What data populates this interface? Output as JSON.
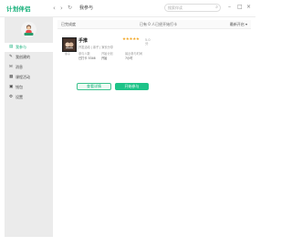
{
  "app": {
    "logo": "计划伴侣"
  },
  "titlebar": {
    "back_icon": "‹",
    "forward_icon": "›",
    "refresh_icon": "↻",
    "tab_title": "我参与",
    "search_placeholder": "搜索伴读",
    "window_controls": {
      "minimize": "–",
      "maximize": "□",
      "close": "×"
    }
  },
  "sidebar": {
    "user": {
      "name": "",
      "subtitle": ""
    },
    "items": [
      {
        "label": "我参与",
        "icon": "book-icon",
        "glyph": "▤",
        "active": true
      },
      {
        "label": "我创建的",
        "icon": "edit-icon",
        "glyph": "✎",
        "active": false
      },
      {
        "label": "消息",
        "icon": "message-icon",
        "glyph": "✉",
        "active": false
      },
      {
        "label": "课程活动",
        "icon": "calendar-icon",
        "glyph": "▦",
        "active": false
      },
      {
        "label": "钱包",
        "icon": "wallet-icon",
        "glyph": "▣",
        "active": false
      },
      {
        "label": "设置",
        "icon": "gear-icon",
        "glyph": "⚙",
        "active": false
      }
    ]
  },
  "toolbar": {
    "left": "已完成度",
    "middle": "已有 0 人已经开始打卡",
    "right": "最新开启 ▾"
  },
  "plan": {
    "name": "手推",
    "stars": "★★★★★",
    "score": "5.0分",
    "meta": "开发活动 | 亲子 | 家长分享",
    "tag": "亲子",
    "fields": [
      {
        "label": "参与人数",
        "value": "已打卡 5346"
      },
      {
        "label": "开始计划",
        "value": "开始"
      },
      {
        "label": "最近参与时间",
        "value": "7小时"
      }
    ],
    "btn_detail": "查看详情",
    "btn_join": "开始参与"
  },
  "colors": {
    "accent": "#1ec388",
    "star": "#f2a623",
    "sidebar_bg": "#ebebeb"
  }
}
